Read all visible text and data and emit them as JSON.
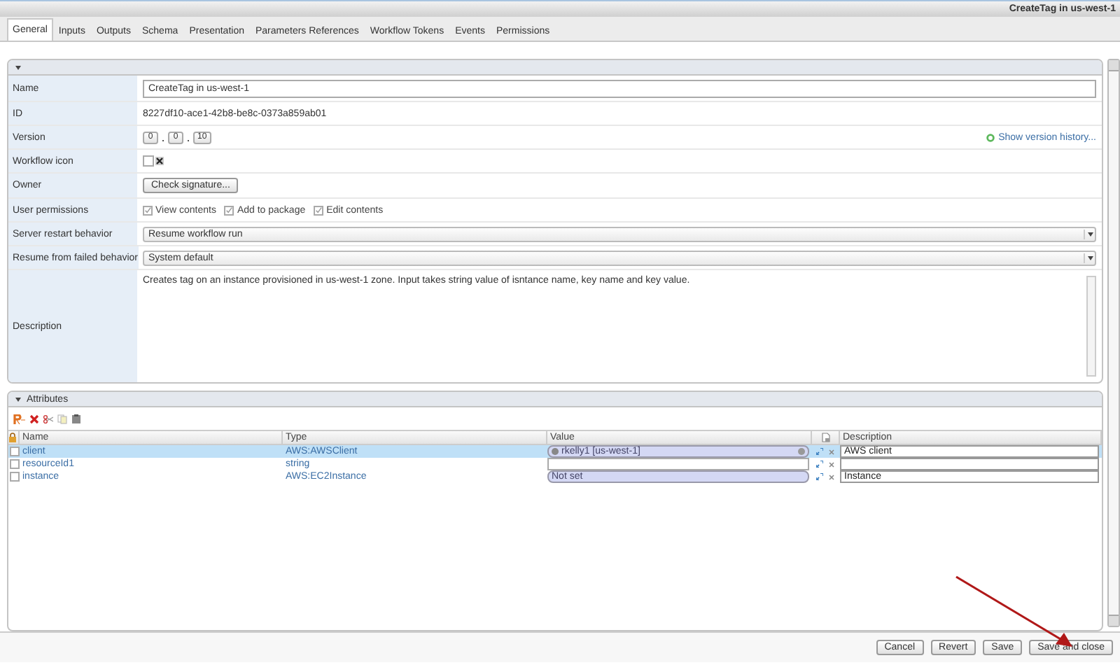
{
  "window": {
    "title": "CreateTag in us-west-1"
  },
  "tabs": [
    {
      "label": "General",
      "selected": true
    },
    {
      "label": "Inputs",
      "selected": false
    },
    {
      "label": "Outputs",
      "selected": false
    },
    {
      "label": "Schema",
      "selected": false
    },
    {
      "label": "Presentation",
      "selected": false
    },
    {
      "label": "Parameters References",
      "selected": false
    },
    {
      "label": "Workflow Tokens",
      "selected": false
    },
    {
      "label": "Events",
      "selected": false
    },
    {
      "label": "Permissions",
      "selected": false
    }
  ],
  "general": {
    "name": {
      "label": "Name",
      "value": "CreateTag in us-west-1"
    },
    "id": {
      "label": "ID",
      "value": "8227df10-ace1-42b8-be8c-0373a859ab01"
    },
    "version": {
      "label": "Version",
      "parts": [
        "0",
        "0",
        "10"
      ],
      "history_link": "Show version history..."
    },
    "workflow_icon": {
      "label": "Workflow icon"
    },
    "owner": {
      "label": "Owner",
      "button": "Check signature..."
    },
    "permissions": {
      "label": "User permissions",
      "options": [
        {
          "label": "View contents",
          "checked": true
        },
        {
          "label": "Add to package",
          "checked": true
        },
        {
          "label": "Edit contents",
          "checked": true
        }
      ]
    },
    "server_restart": {
      "label": "Server restart behavior",
      "value": "Resume workflow run"
    },
    "resume_failed": {
      "label": "Resume from failed behavior",
      "value": "System default"
    },
    "description": {
      "label": "Description",
      "value": "Creates tag on an instance provisioned in us-west-1 zone. Input takes string value of isntance name, key name and key value."
    }
  },
  "attributes": {
    "title": "Attributes",
    "columns": [
      "Name",
      "Type",
      "Value",
      "Description"
    ],
    "rows": [
      {
        "name": "client",
        "type": "AWS:AWSClient",
        "kind": "object",
        "value": "rkelly1 [us-west-1]",
        "description": "AWS client",
        "selected": true
      },
      {
        "name": "resourceId1",
        "type": "string",
        "kind": "empty",
        "selected": false
      },
      {
        "name": "instance",
        "type": "AWS:EC2Instance",
        "kind": "unset",
        "value": "Not set",
        "description": "Instance",
        "selected": false
      }
    ]
  },
  "buttons": [
    "Cancel",
    "Revert",
    "Save",
    "Save and close"
  ]
}
